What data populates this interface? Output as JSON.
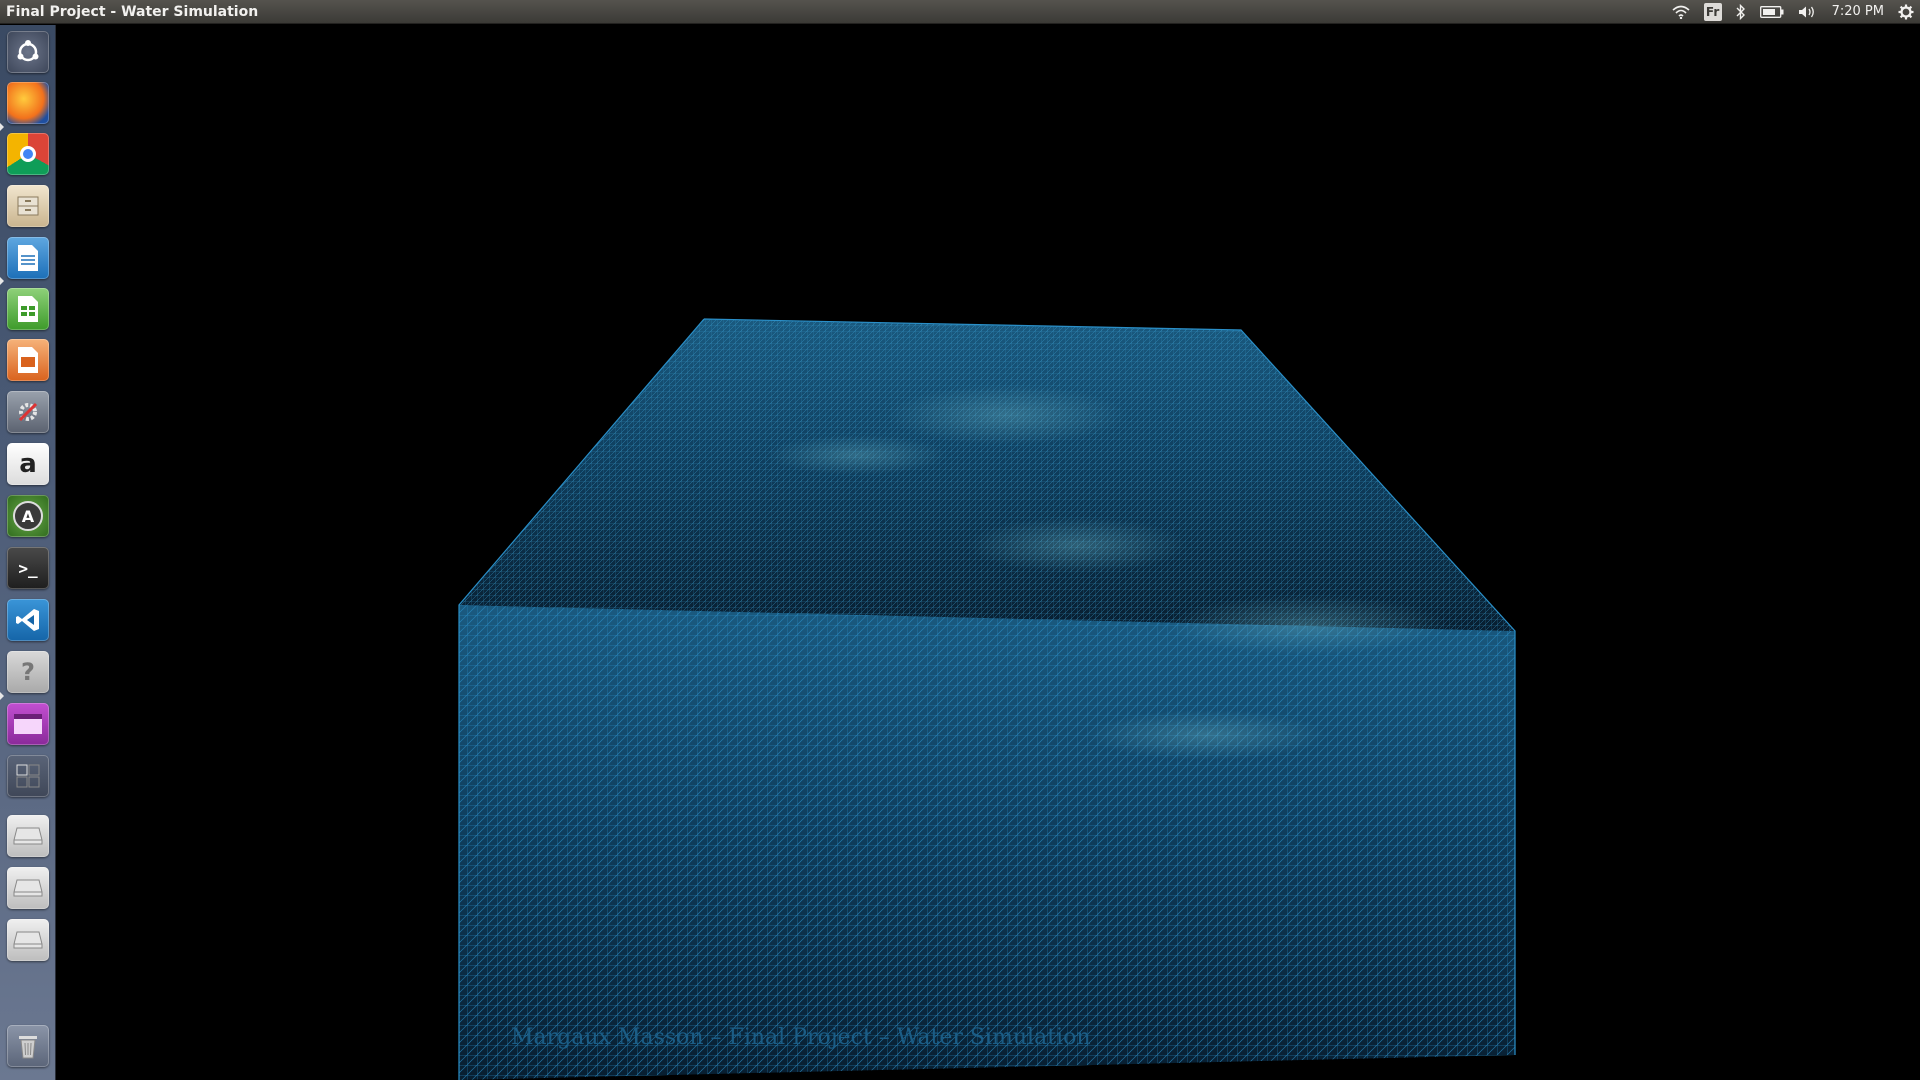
{
  "window": {
    "title": "Final Project - Water Simulation"
  },
  "panel": {
    "keyboard_layout": "Fr",
    "clock": "7:20 PM",
    "indicators": [
      "wifi-icon",
      "keyboard-layout",
      "bluetooth-icon",
      "battery-icon",
      "volume-icon",
      "clock",
      "gear-icon"
    ]
  },
  "launcher": {
    "items": [
      {
        "name": "ubuntu-dash",
        "icon": "ubuntu-logo-icon"
      },
      {
        "name": "firefox",
        "icon": "firefox-icon",
        "running": true
      },
      {
        "name": "chrome",
        "icon": "chrome-icon"
      },
      {
        "name": "files",
        "icon": "file-cabinet-icon"
      },
      {
        "name": "libreoffice-writer",
        "icon": "writer-icon",
        "running": true
      },
      {
        "name": "libreoffice-calc",
        "icon": "calc-icon"
      },
      {
        "name": "libreoffice-impress",
        "icon": "impress-icon"
      },
      {
        "name": "system-settings",
        "icon": "settings-tools-icon"
      },
      {
        "name": "amazon",
        "icon": "amazon-icon",
        "glyph": "a"
      },
      {
        "name": "software-updater",
        "icon": "updater-icon",
        "glyph": "A"
      },
      {
        "name": "terminal",
        "icon": "terminal-icon",
        "glyph": ">_"
      },
      {
        "name": "vscode",
        "icon": "vscode-icon"
      },
      {
        "name": "help",
        "icon": "help-icon",
        "glyph": "?",
        "running": true
      },
      {
        "name": "app-window",
        "icon": "purple-app-icon"
      },
      {
        "name": "workspace-switcher",
        "icon": "workspaces-icon"
      },
      {
        "name": "drive-1",
        "icon": "drive-icon"
      },
      {
        "name": "drive-2",
        "icon": "drive-icon"
      },
      {
        "name": "drive-3",
        "icon": "drive-icon"
      },
      {
        "name": "trash",
        "icon": "trash-icon"
      }
    ]
  },
  "scene": {
    "credit": "Margaux Masson – Final Project – Water Simulation",
    "mesh_color": "#2a8fc8",
    "water_color": "#0d3550"
  }
}
